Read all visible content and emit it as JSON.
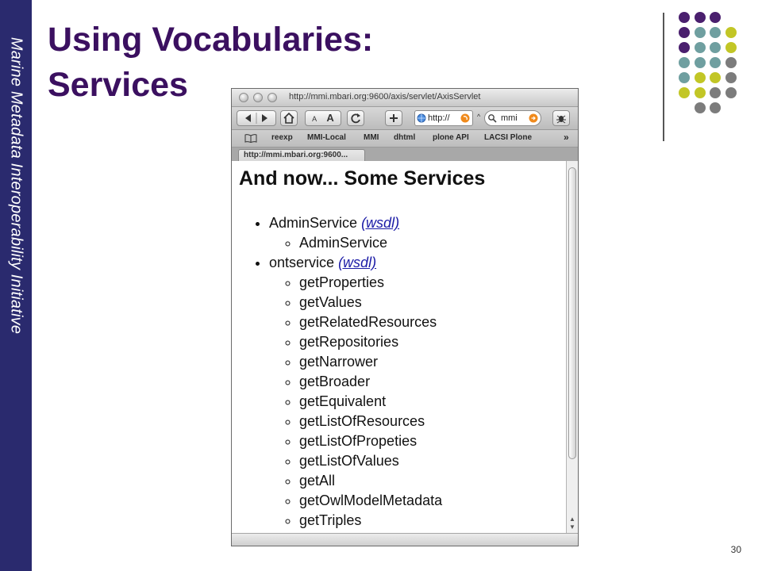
{
  "slide": {
    "side_text": "Marine Metadata Interoperability Initiative",
    "title_line1": "Using Vocabularies:",
    "title_line2": "Services",
    "page_number": "30"
  },
  "colors": {
    "side_band": "#2a2a6e",
    "title": "#3b1060",
    "dots": {
      "purple": "#4a1f6e",
      "teal": "#6f9fa0",
      "lime": "#c2c626",
      "gray": "#7c7c7c"
    }
  },
  "decoration": {
    "dot_rows": [
      [
        "purple",
        "purple",
        "purple"
      ],
      [
        "purple",
        "teal",
        "teal",
        "lime"
      ],
      [
        "purple",
        "teal",
        "teal",
        "lime"
      ],
      [
        "teal",
        "teal",
        "teal",
        "gray"
      ],
      [
        "teal",
        "lime",
        "lime",
        "gray"
      ],
      [
        "lime",
        "lime",
        "gray",
        "gray"
      ],
      [
        "gray",
        "gray"
      ]
    ]
  },
  "browser": {
    "window_title": "http://mmi.mbari.org:9600/axis/servlet/AxisServlet",
    "toolbar": {
      "back_icon": "back-arrow-icon",
      "forward_icon": "forward-arrow-icon",
      "home_icon": "home-icon",
      "text_smaller": "A",
      "text_larger": "A",
      "reload_icon": "reload-icon",
      "add_icon": "plus-icon",
      "url_value": "http://",
      "search_value": "mmi",
      "bug_icon": "bug-icon"
    },
    "bookmarks": [
      "reexp",
      "MMI-Local",
      "MMI",
      "dhtml",
      "plone API",
      "LACSI Plone"
    ],
    "tab_label": "http://mmi.mbari.org:9600...",
    "page": {
      "heading": "And now... Some Services",
      "services": [
        {
          "name": "AdminService",
          "link": "(wsdl)",
          "methods": [
            "AdminService"
          ]
        },
        {
          "name": "ontservice",
          "link": "(wsdl)",
          "methods": [
            "getProperties",
            "getValues",
            "getRelatedResources",
            "getRepositories",
            "getNarrower",
            "getBroader",
            "getEquivalent",
            "getListOfResources",
            "getListOfPropeties",
            "getListOfValues",
            "getAll",
            "getOwlModelMetadata",
            "getTriples"
          ]
        }
      ]
    }
  }
}
